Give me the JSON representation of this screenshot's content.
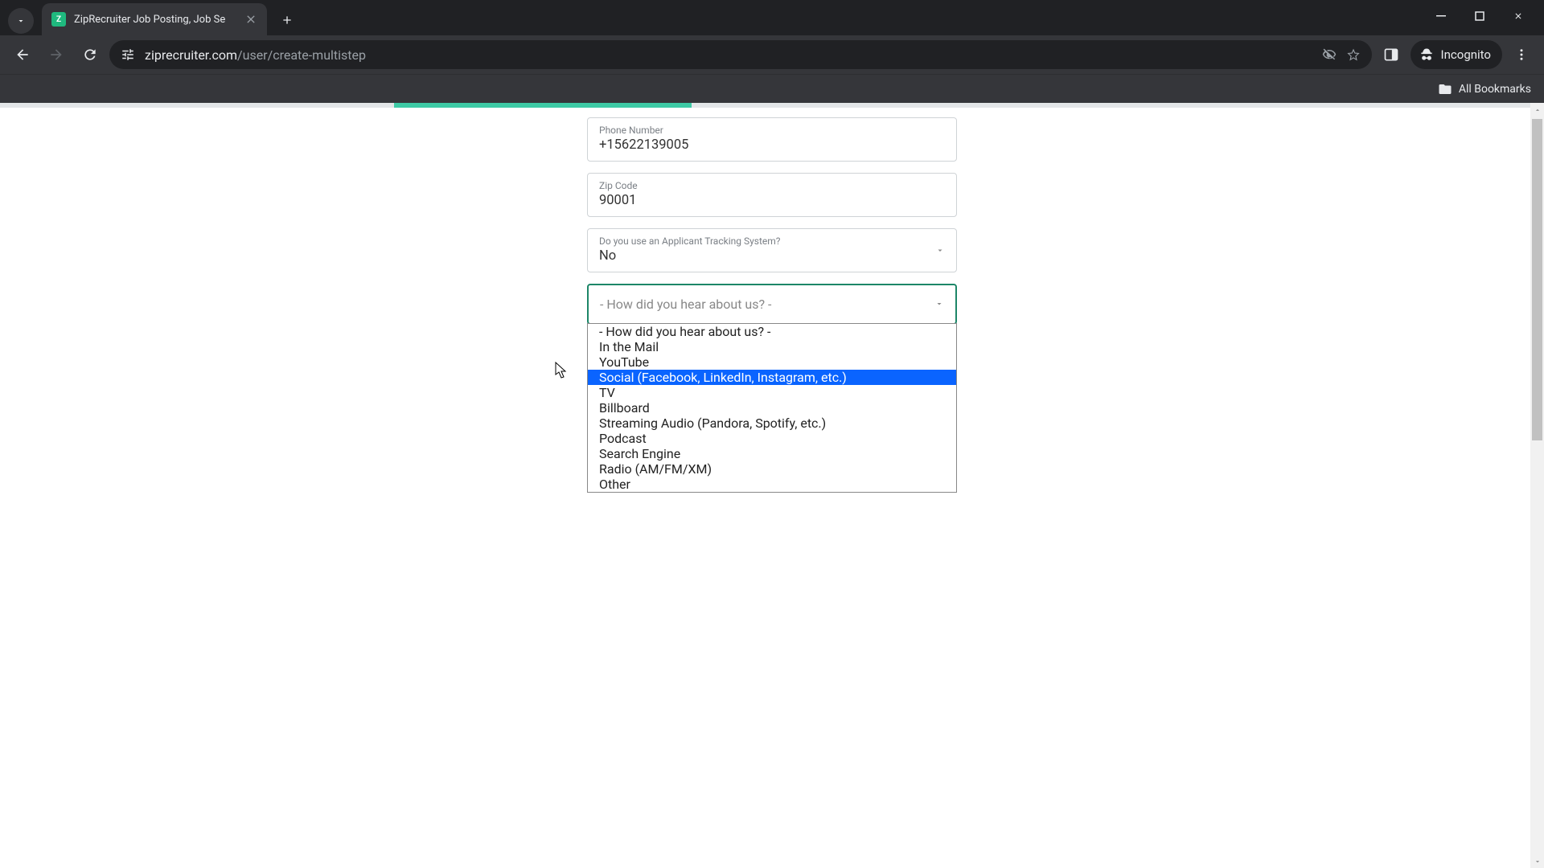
{
  "browser": {
    "tab_title": "ZipRecruiter Job Posting, Job Se",
    "url_domain": "ziprecruiter.com",
    "url_path": "/user/create-multistep",
    "incognito_label": "Incognito",
    "bookmarks_label": "All Bookmarks"
  },
  "form": {
    "phone": {
      "label": "Phone Number",
      "value": "+15622139005"
    },
    "zip": {
      "label": "Zip Code",
      "value": "90001"
    },
    "ats": {
      "label": "Do you use an Applicant Tracking System?",
      "value": "No"
    },
    "source": {
      "placeholder": "- How did you hear about us? -",
      "highlighted_index": 3,
      "options": [
        "- How did you hear about us? -",
        "In the Mail",
        "YouTube",
        "Social (Facebook, LinkedIn, Instagram, etc.)",
        "TV",
        "Billboard",
        "Streaming Audio (Pandora, Spotify, etc.)",
        "Podcast",
        "Search Engine",
        "Radio (AM/FM/XM)",
        "Other"
      ]
    }
  }
}
